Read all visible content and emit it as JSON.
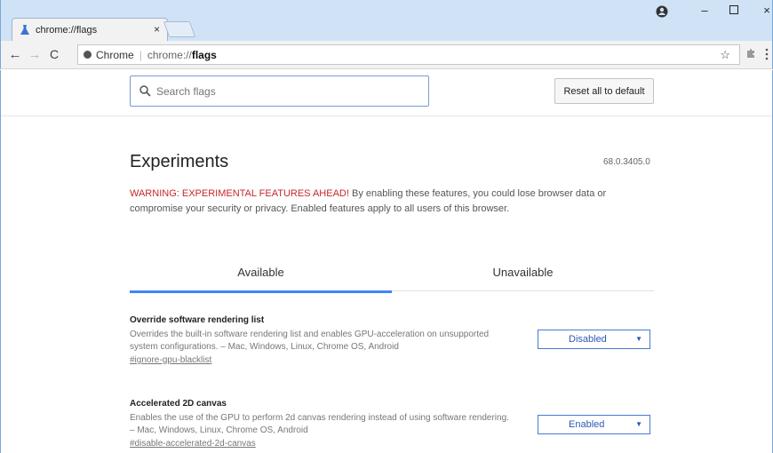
{
  "window": {
    "tab_title": "chrome://flags",
    "tab_close": "×",
    "minimize": "–",
    "close": "×"
  },
  "toolbar": {
    "back": "←",
    "forward": "→",
    "reload": "C",
    "omnibox": {
      "scheme_label": "Chrome",
      "separator": "|",
      "host": "chrome://",
      "path": "flags"
    },
    "bookmark_star": "☆"
  },
  "search": {
    "placeholder": "Search flags",
    "reset_label": "Reset all to default"
  },
  "header": {
    "title": "Experiments",
    "version": "68.0.3405.0",
    "warning_red": "WARNING: EXPERIMENTAL FEATURES AHEAD!",
    "warning_text": " By enabling these features, you could lose browser data or compromise your security or privacy. Enabled features apply to all users of this browser."
  },
  "tabs": [
    {
      "label": "Available",
      "active": true
    },
    {
      "label": "Unavailable",
      "active": false
    }
  ],
  "flags": [
    {
      "name": "Override software rendering list",
      "description": "Overrides the built-in software rendering list and enables GPU-acceleration on unsupported system configurations. – Mac, Windows, Linux, Chrome OS, Android",
      "link": "#ignore-gpu-blacklist",
      "value": "Disabled"
    },
    {
      "name": "Accelerated 2D canvas",
      "description": "Enables the use of the GPU to perform 2d canvas rendering instead of using software rendering. – Mac, Windows, Linux, Chrome OS, Android",
      "link": "#disable-accelerated-2d-canvas",
      "value": "Enabled"
    }
  ],
  "colors": {
    "accent": "#4285f4",
    "warning": "#c62828",
    "select_text": "#2d58b5"
  }
}
